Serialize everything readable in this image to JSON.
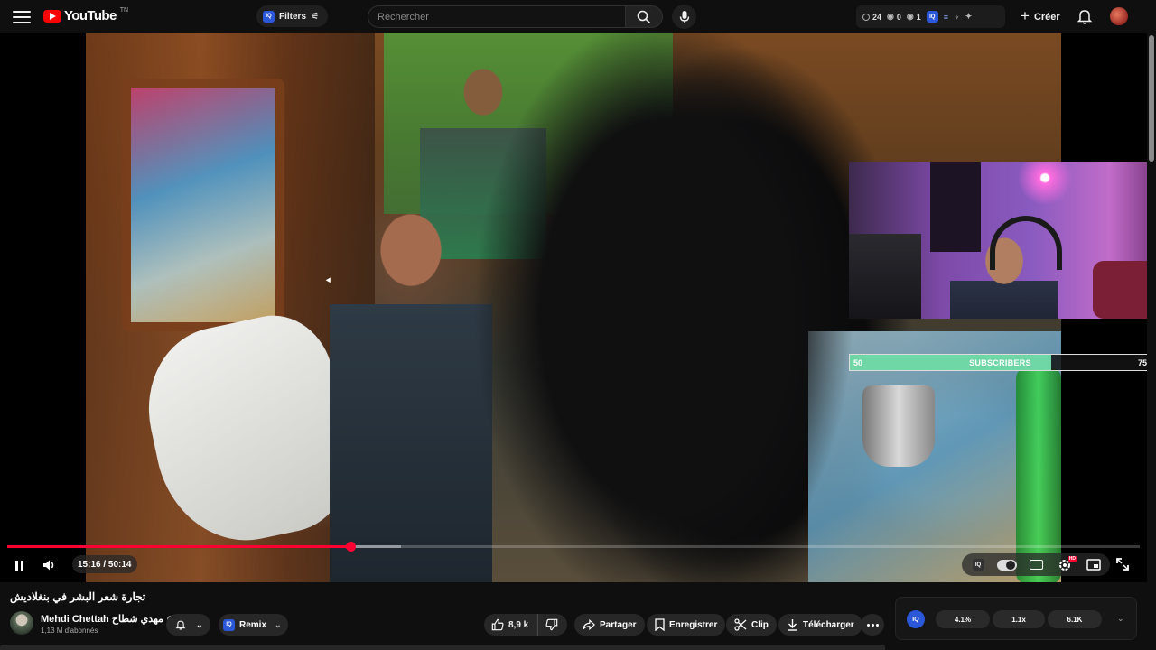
{
  "topbar": {
    "logo_text": "YouTube",
    "logo_tm": "TN",
    "filters_label": "Filters",
    "iq_badge": "IQ",
    "search_placeholder": "Rechercher",
    "ext_stats": {
      "watch_count": "24",
      "stat_a": "0",
      "stat_b": "1"
    },
    "create_label": "Créer"
  },
  "player": {
    "current_time": "15:16",
    "duration": "50:14",
    "time_label": "15:16 / 50:14",
    "progress_fraction": 0.303,
    "buffered_fraction": 0.348,
    "subscriber_bar": {
      "start": "50",
      "label": "SUBSCRIBERS",
      "end": "75",
      "progress_fraction": 0.67
    },
    "iq_button": "IQ",
    "hd_badge": "HD"
  },
  "video": {
    "title": "تجارة شعر البشر في بنغلاديش",
    "channel_name": "Mehdi Chettah مهدي شطاح",
    "subscribers": "1,13 M d'abonnés",
    "remix_label": "Remix",
    "like_count": "8,9 k",
    "share_label": "Partager",
    "save_label": "Enregistrer",
    "clip_label": "Clip",
    "download_label": "Télécharger"
  },
  "iq_panel": {
    "logo": "IQ",
    "stat1": "4.1%",
    "stat2": "1.1x",
    "stat3": "6.1K"
  },
  "colors": {
    "accent_red": "#ff0033",
    "iq_blue": "#2b57d9",
    "subscriber_fill": "#6fd6a6"
  },
  "icons": [
    "menu-icon",
    "youtube-logo-icon",
    "tune-icon",
    "search-icon",
    "mic-icon",
    "clock-icon",
    "eye-icon",
    "plus-icon",
    "bell-icon",
    "pause-icon",
    "volume-icon",
    "settings-icon",
    "captions-icon",
    "miniplayer-icon",
    "fullscreen-icon",
    "bell-notify-icon",
    "chevron-down-icon",
    "thumbs-up-icon",
    "thumbs-down-icon",
    "share-icon",
    "bookmark-icon",
    "scissors-icon",
    "download-icon",
    "more-icon"
  ]
}
